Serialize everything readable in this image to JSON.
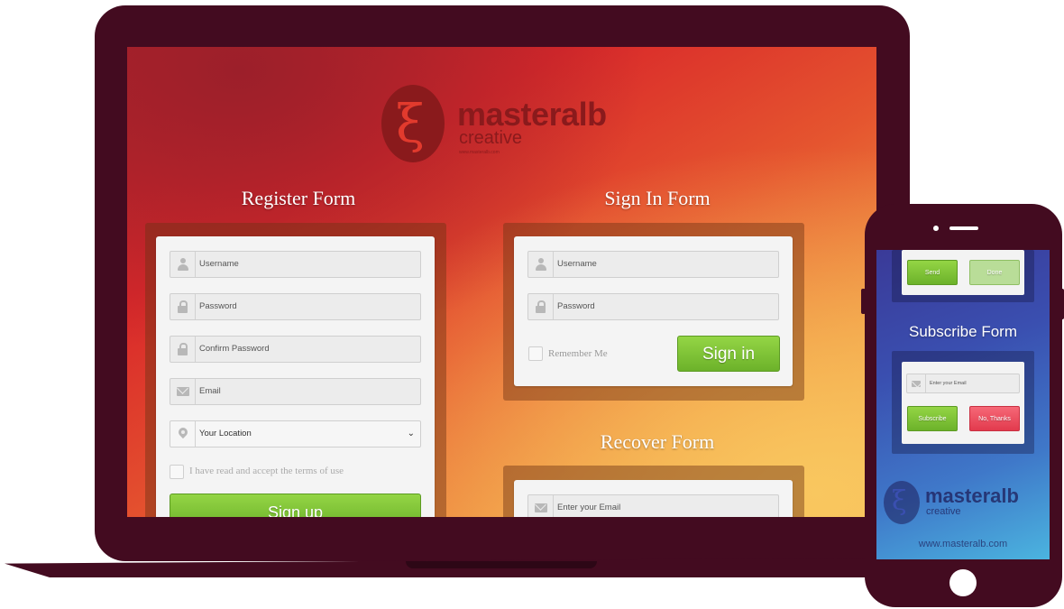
{
  "brand": {
    "logo_word": "masteralb",
    "logo_sub": "creative",
    "logo_tiny": "www.masteralb.com",
    "url": "www.masteralb.com"
  },
  "colors": {
    "device_frame": "#430b20",
    "accent_green": "#7cc234",
    "accent_red": "#f24d5e"
  },
  "register": {
    "title": "Register Form",
    "username_placeholder": "Username",
    "password_placeholder": "Password",
    "confirm_password_placeholder": "Confirm Password",
    "email_placeholder": "Email",
    "location_selected": "Your Location",
    "terms_label": "I have read and accept the terms of use",
    "submit_label": "Sign up"
  },
  "signin": {
    "title": "Sign In Form",
    "username_placeholder": "Username",
    "password_placeholder": "Password",
    "remember_label": "Remember Me",
    "submit_label": "Sign in"
  },
  "recover": {
    "title": "Recover Form",
    "email_placeholder": "Enter your Email"
  },
  "phone": {
    "send_label": "Send",
    "done_label": "Done",
    "subscribe_title": "Subscribe Form",
    "email_placeholder": "Enter your Email",
    "subscribe_label": "Subscribe",
    "no_thanks_label": "No, Thanks"
  },
  "icons": [
    "user-icon",
    "lock-icon",
    "mail-icon",
    "location-pin-icon",
    "chevron-down-icon"
  ]
}
